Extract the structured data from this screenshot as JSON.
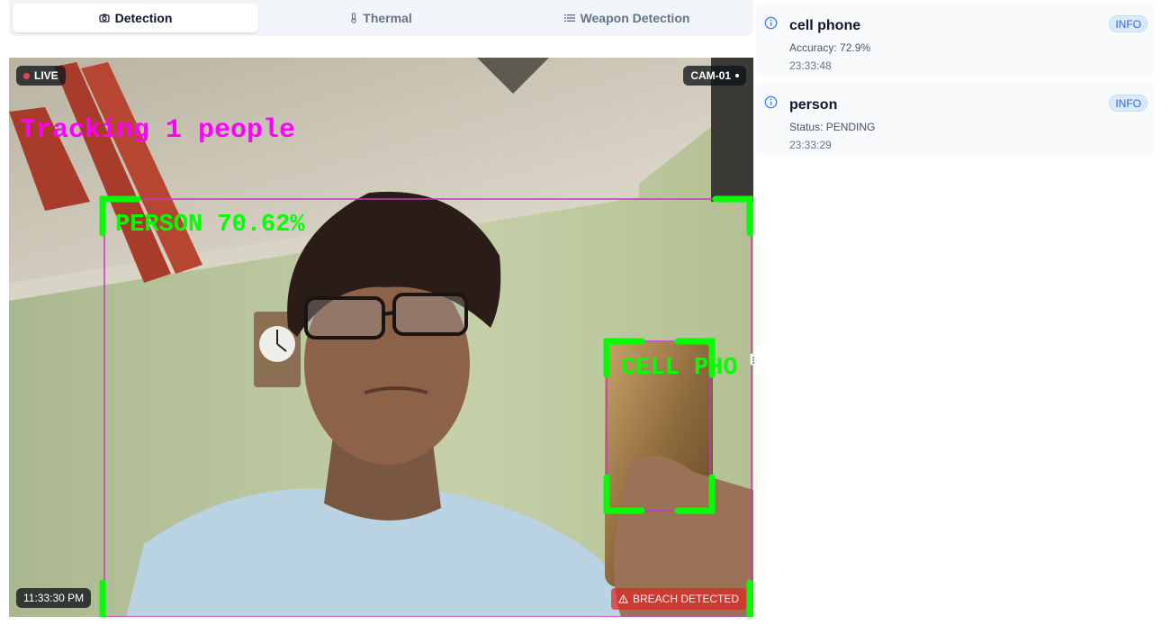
{
  "tabs": [
    {
      "label": "Detection",
      "icon": "camera-icon",
      "active": true
    },
    {
      "label": "Thermal",
      "icon": "thermometer-icon",
      "active": false
    },
    {
      "label": "Weapon Detection",
      "icon": "list-icon",
      "active": false
    }
  ],
  "camera": {
    "live_label": "LIVE",
    "camera_id": "CAM-01",
    "timestamp": "11:33:30 PM",
    "breach_label": "BREACH DETECTED",
    "overlay": {
      "tracking_text": "Tracking 1 people",
      "detections": [
        {
          "label": "PERSON 70.62%"
        },
        {
          "label": "CELL PHO"
        }
      ]
    }
  },
  "alerts": [
    {
      "title": "cell phone",
      "detail": "Accuracy: 72.9%",
      "time": "23:33:48",
      "badge": "INFO"
    },
    {
      "title": "person",
      "detail": "Status: PENDING",
      "time": "23:33:29",
      "badge": "INFO"
    }
  ],
  "colors": {
    "tracking": "#ff00ff",
    "detection_box": "#00ff00",
    "live_dot": "#ef4444",
    "info_badge": "#2563eb"
  }
}
